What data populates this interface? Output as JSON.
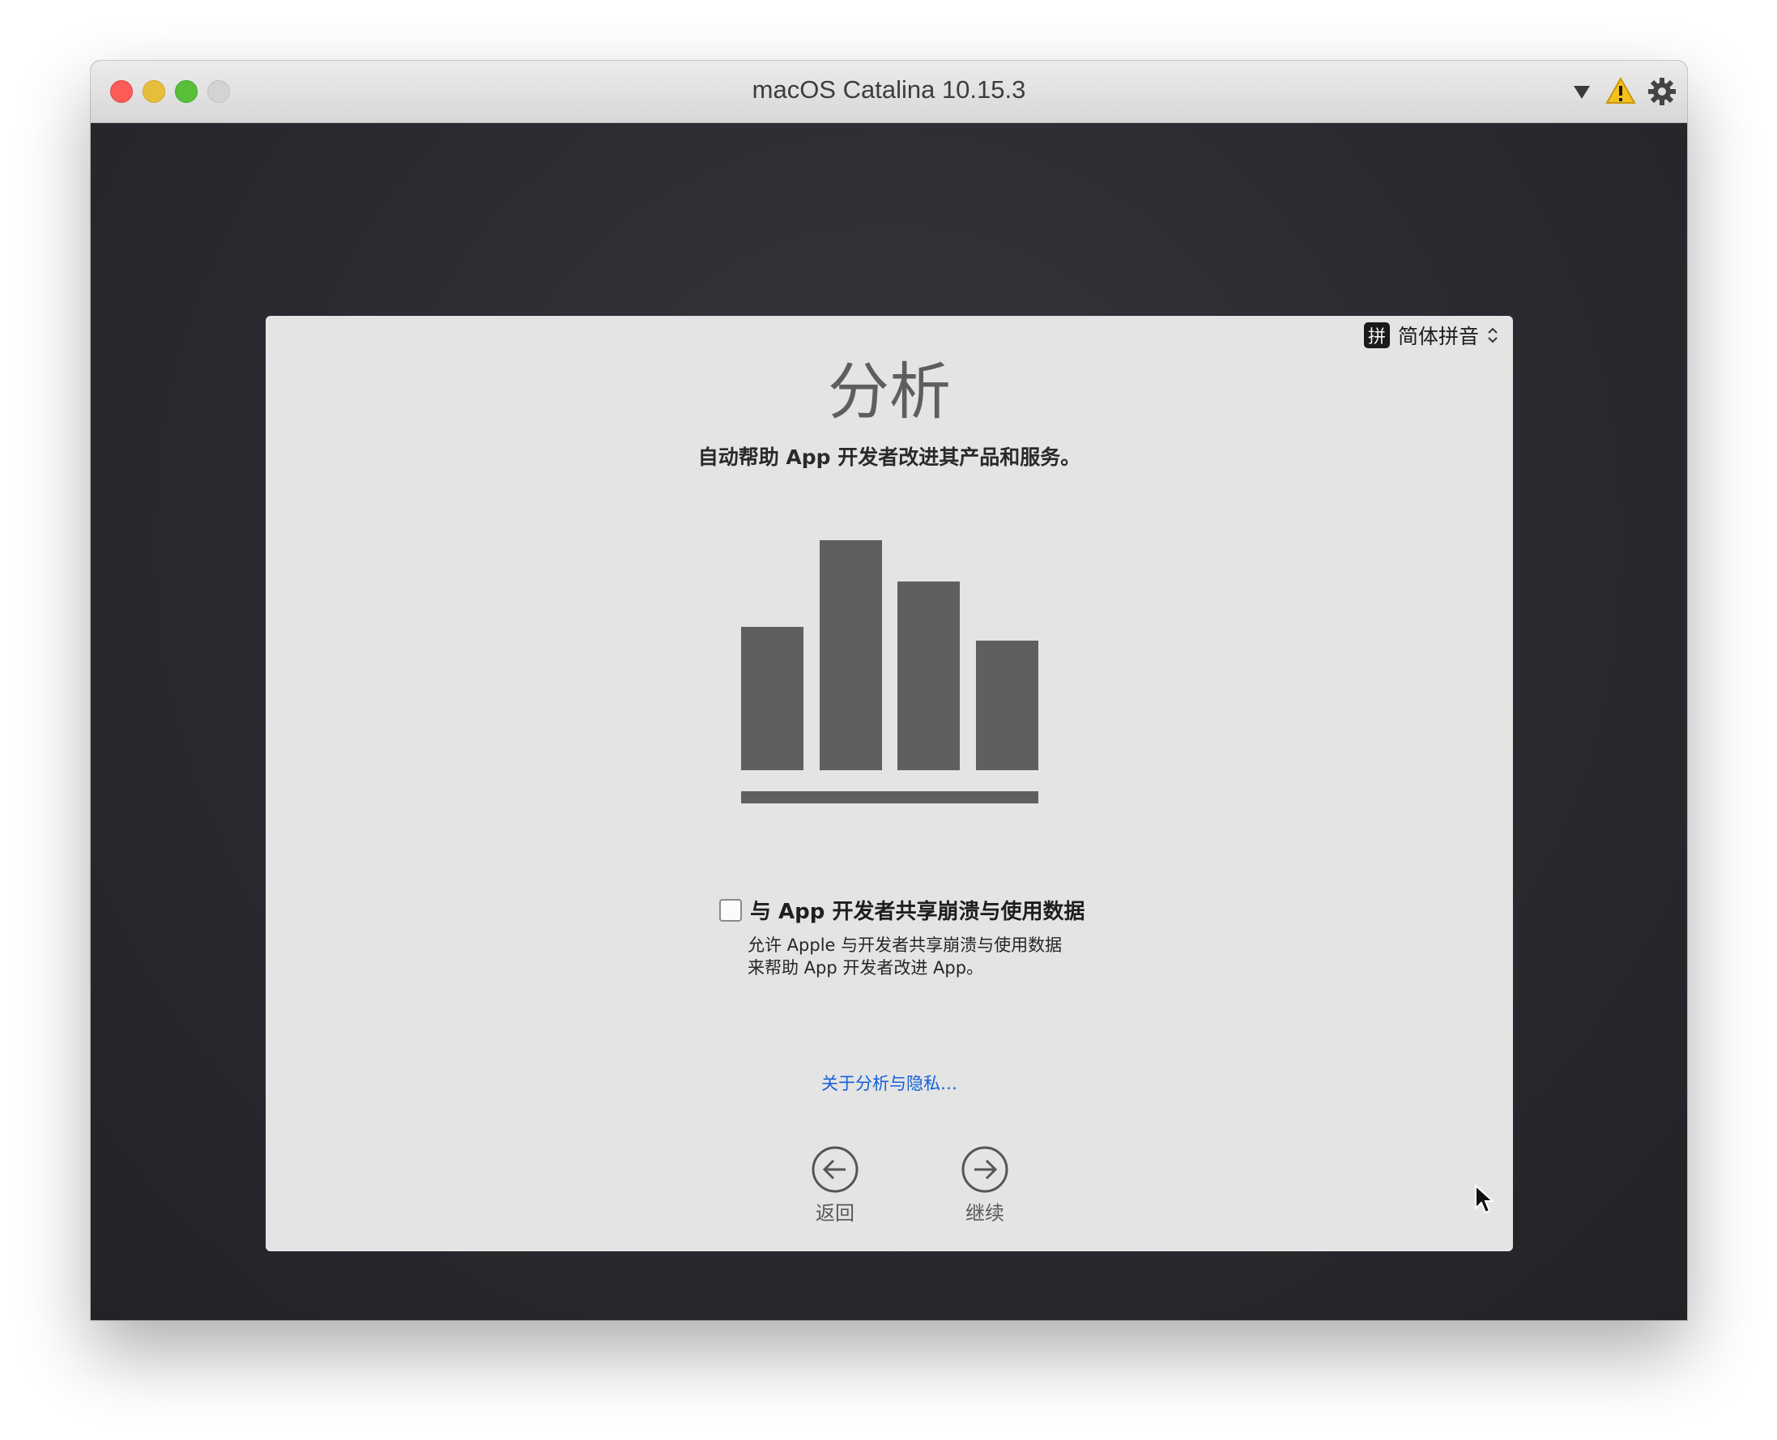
{
  "window": {
    "title": "macOS Catalina 10.15.3",
    "toolbar_icons": [
      "dropdown-triangle-icon",
      "warning-icon",
      "gear-icon"
    ]
  },
  "input_source": {
    "badge": "拼",
    "label": "简体拼音"
  },
  "page": {
    "title": "分析",
    "subtitle": "自动帮助 App 开发者改进其产品和服务。",
    "illustration_icon": "bar-chart-icon",
    "checkbox": {
      "label": "与 App 开发者共享崩溃与使用数据",
      "checked": false
    },
    "description_line1": "允许 Apple 与开发者共享崩溃与使用数据",
    "description_line2": "来帮助 App 开发者改进 App。",
    "privacy_link": "关于分析与隐私…",
    "back_label": "返回",
    "continue_label": "继续"
  },
  "colors": {
    "panel_bg": "#e4e4e4",
    "bar_color": "#5f5f5f",
    "link_color": "#1360d8",
    "desktop_bg": "#2b2c30"
  }
}
